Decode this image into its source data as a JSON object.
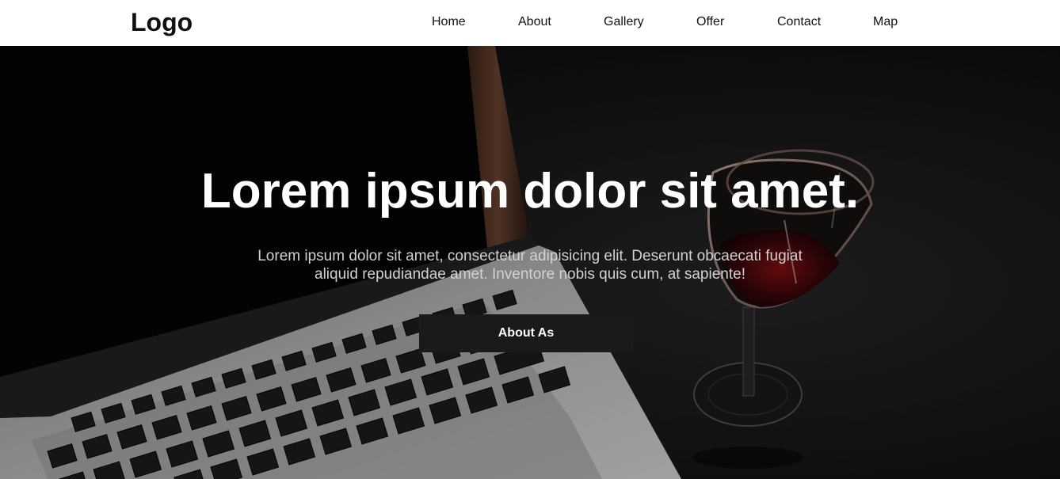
{
  "header": {
    "logo_text": "Logo",
    "nav": [
      {
        "label": "Home"
      },
      {
        "label": "About"
      },
      {
        "label": "Gallery"
      },
      {
        "label": "Offer"
      },
      {
        "label": "Contact"
      },
      {
        "label": "Map"
      }
    ]
  },
  "hero": {
    "background_subject": [
      "laptop",
      "wine-glass"
    ],
    "title": "Lorem ipsum dolor sit amet.",
    "text_line1": "Lorem ipsum dolor sit amet, consectetur adipisicing elit. Deserunt obcaecati fugiat",
    "text_line2": "aliquid repudiandae amet. Inventore nobis quis cum, at sapiente!",
    "button_label": "About As"
  },
  "colors": {
    "header_bg": "#ffffff",
    "hero_bg": "#0a0a0a",
    "button_bg": "#1a1a1a",
    "text_primary": "#ffffff",
    "text_secondary": "#d2d2d2"
  }
}
